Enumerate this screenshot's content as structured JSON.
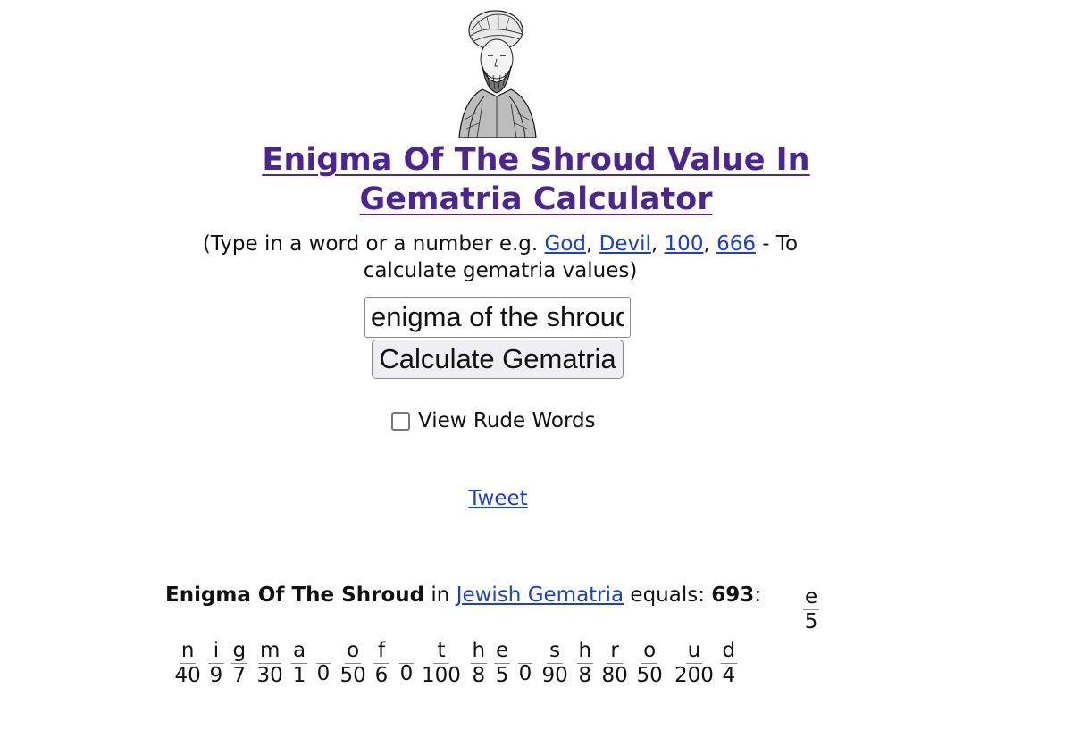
{
  "header": {
    "title_line1": "Enigma Of The Shroud Value In",
    "title_line2": "Gematria Calculator",
    "subtitle_prefix": "(Type in a word or a number e.g. ",
    "examples": [
      "God",
      "Devil",
      "100",
      "666"
    ],
    "sep1": ", ",
    "sep2": ", ",
    "sep3": ", ",
    "subtitle_suffix": " - To calculate gematria values)"
  },
  "form": {
    "input_value": "enigma of the shroud",
    "button_label": "Calculate Gematria",
    "checkbox_label": "View Rude Words",
    "checkbox_checked": false
  },
  "tweet_label": "Tweet",
  "result": {
    "phrase": "Enigma Of The Shroud",
    "in_text": " in ",
    "method_link": "Jewish Gematria",
    "equals_text": " equals: ",
    "total": "693",
    "colon": ":"
  },
  "letters": [
    {
      "ch": "e",
      "val": "5"
    },
    {
      "ch": "n",
      "val": "40"
    },
    {
      "ch": "i",
      "val": "9"
    },
    {
      "ch": "g",
      "val": "7"
    },
    {
      "ch": "m",
      "val": "30"
    },
    {
      "ch": "a",
      "val": "1"
    },
    {
      "ch": " ",
      "val": "0"
    },
    {
      "ch": "o",
      "val": "50"
    },
    {
      "ch": "f",
      "val": "6"
    },
    {
      "ch": " ",
      "val": "0"
    },
    {
      "ch": "t",
      "val": "100"
    },
    {
      "ch": "h",
      "val": "8"
    },
    {
      "ch": "e",
      "val": "5"
    },
    {
      "ch": " ",
      "val": "0"
    },
    {
      "ch": "s",
      "val": "90"
    },
    {
      "ch": "h",
      "val": "8"
    },
    {
      "ch": "r",
      "val": "80"
    },
    {
      "ch": "o",
      "val": "50"
    },
    {
      "ch": "u",
      "val": "200"
    },
    {
      "ch": "d",
      "val": "4"
    }
  ]
}
